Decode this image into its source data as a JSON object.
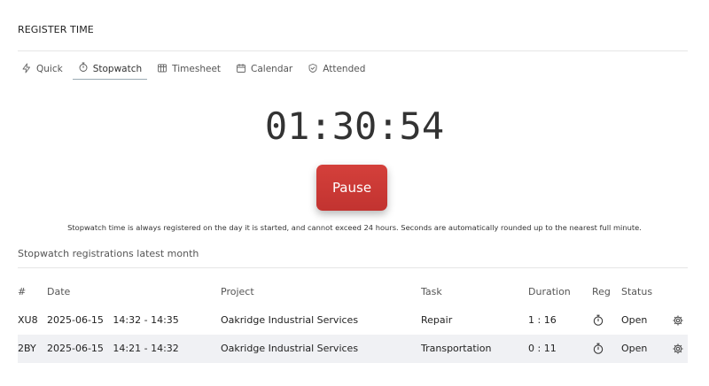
{
  "page_title": "REGISTER TIME",
  "tabs": [
    {
      "label": "Quick",
      "icon": "bolt-icon"
    },
    {
      "label": "Stopwatch",
      "icon": "stopwatch-icon",
      "active": true
    },
    {
      "label": "Timesheet",
      "icon": "table-icon"
    },
    {
      "label": "Calendar",
      "icon": "calendar-icon"
    },
    {
      "label": "Attended",
      "icon": "shield-check-icon"
    }
  ],
  "timer": {
    "value": "01:30:54"
  },
  "pause_button": {
    "label": "Pause",
    "color": "#c8362f"
  },
  "note": "Stopwatch time is always registered on the day it is started, and cannot exceed 24 hours. Seconds are automatically rounded up to the nearest full minute.",
  "registrations": {
    "title": "Stopwatch registrations latest month",
    "columns": {
      "num": "#",
      "date": "Date",
      "project": "Project",
      "task": "Task",
      "duration": "Duration",
      "reg": "Reg",
      "status": "Status"
    },
    "rows": [
      {
        "num": "XU8",
        "date": "2025-06-15   14:32 - 14:35",
        "project": "Oakridge Industrial Services",
        "task": "Repair",
        "duration": "1 : 16",
        "reg_icon": "stopwatch-icon",
        "status": "Open",
        "action_icon": "gear-icon"
      },
      {
        "num": "2BY",
        "date": "2025-06-15   14:21 - 14:32",
        "project": "Oakridge Industrial Services",
        "task": "Transportation",
        "duration": "0 : 11",
        "reg_icon": "stopwatch-icon",
        "status": "Open",
        "action_icon": "gear-icon"
      }
    ]
  }
}
